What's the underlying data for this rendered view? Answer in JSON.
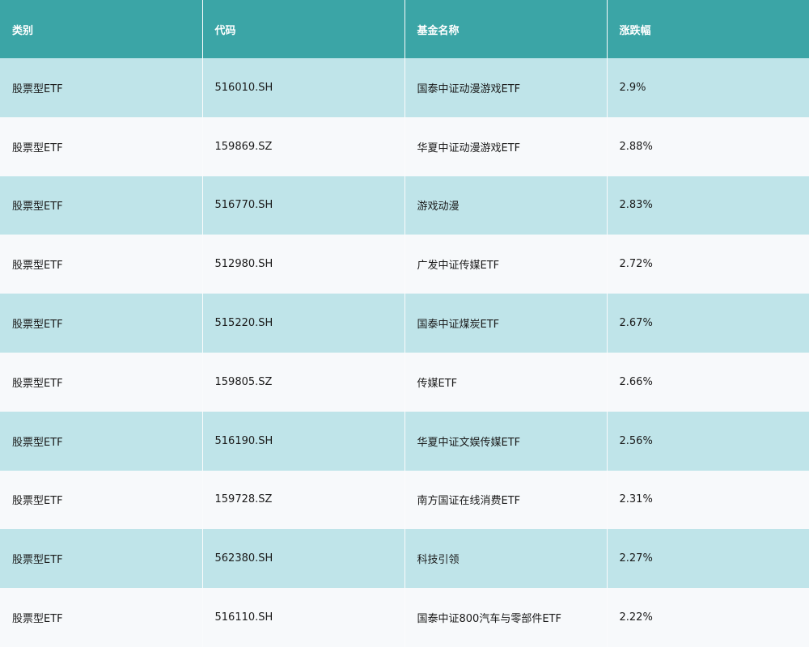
{
  "colors": {
    "header_bg": "#3ba5a6",
    "header_text": "#ffffff",
    "row_odd_bg": "#bfe4e9",
    "row_even_bg": "#f7f9fb"
  },
  "table": {
    "headers": [
      "类别",
      "代码",
      "基金名称",
      "涨跌幅"
    ],
    "rows": [
      [
        "股票型ETF",
        "516010.SH",
        "国泰中证动漫游戏ETF",
        "2.9%"
      ],
      [
        "股票型ETF",
        "159869.SZ",
        "华夏中证动漫游戏ETF",
        "2.88%"
      ],
      [
        "股票型ETF",
        "516770.SH",
        "游戏动漫",
        "2.83%"
      ],
      [
        "股票型ETF",
        "512980.SH",
        "广发中证传媒ETF",
        "2.72%"
      ],
      [
        "股票型ETF",
        "515220.SH",
        "国泰中证煤炭ETF",
        "2.67%"
      ],
      [
        "股票型ETF",
        "159805.SZ",
        "传媒ETF",
        "2.66%"
      ],
      [
        "股票型ETF",
        "516190.SH",
        "华夏中证文娱传媒ETF",
        "2.56%"
      ],
      [
        "股票型ETF",
        "159728.SZ",
        "南方国证在线消费ETF",
        "2.31%"
      ],
      [
        "股票型ETF",
        "562380.SH",
        "科技引领",
        "2.27%"
      ],
      [
        "股票型ETF",
        "516110.SH",
        "国泰中证800汽车与零部件ETF",
        "2.22%"
      ]
    ]
  }
}
